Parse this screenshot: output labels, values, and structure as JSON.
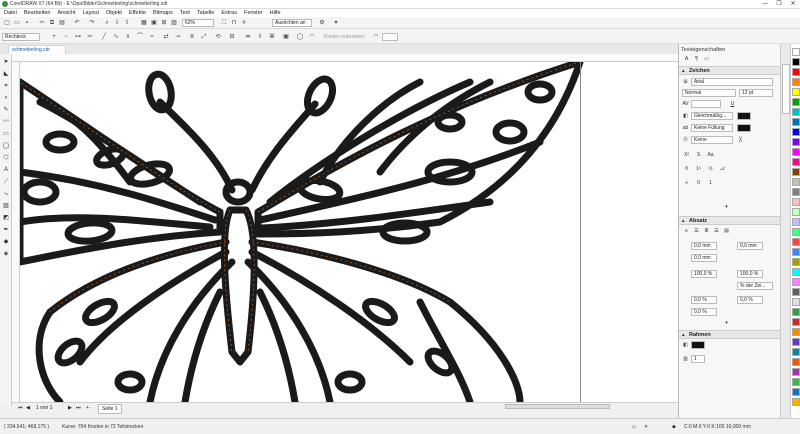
{
  "window": {
    "title": "CorelDRAW X7 (64 Bit) - E:\\Opa\\Bilder\\Schmetterling\\schmetterling.cdr",
    "controls": [
      "—",
      "❐",
      "✕"
    ]
  },
  "menu": [
    "Datei",
    "Bearbeiten",
    "Ansicht",
    "Layout",
    "Objekt",
    "Effekte",
    "Bitmaps",
    "Text",
    "Tabelle",
    "Extras",
    "Fenster",
    "Hilfe"
  ],
  "toolbar": {
    "zoom": "62%",
    "snap": "Ausrichten an",
    "object_type": "Rechteck",
    "smooth_label": "Knoten reduzieren"
  },
  "doc_tab": "schmetterling.cdr",
  "panel": {
    "title": "Texteigenschaften",
    "zeichen": {
      "title": "Zeichen",
      "font": "Arial",
      "style": "Normal",
      "size": "12 pt",
      "fill_uniform": "Gleichmäßig...",
      "fill_none": "Keine Füllung",
      "outline": "Keine"
    },
    "absatz": {
      "title": "Absatz",
      "indent_left": "0,0 mm",
      "indent_right": "0,0 mm",
      "indent_first": "0,0 mm",
      "line_spacing": "100,0 %",
      "char_spacing": "100,0 %",
      "spacing_unit": "% der Zei...",
      "before": "0,0 %",
      "after": "0,0 %",
      "word_spacing": "0,0 %"
    },
    "rahmen": {
      "title": "Rahmen",
      "columns": "1"
    }
  },
  "pagebar": {
    "pages": "1 von 1",
    "page_name": "Seite 1"
  },
  "status": {
    "coords": "( 334,541; 468,175 )",
    "info": "Kurve: 704 Knoten in 72 Teilstrecken",
    "color": "C:0 M:0 Y:0 K:100  10,000 mm"
  },
  "colors": {
    "accent": "#1d5aa8",
    "outline": "#1a1a1a",
    "nodes": "#e0701a"
  },
  "palette": [
    "#ffffff",
    "#000000",
    "#ff0000",
    "#ff8000",
    "#ffff00",
    "#00a000",
    "#00c0c0",
    "#0070c0",
    "#0000ff",
    "#8000ff",
    "#ff00ff",
    "#ff0080",
    "#804000",
    "#c0c0c0",
    "#808080",
    "#ffc0c0",
    "#c0ffc0",
    "#c0c0ff",
    "#40ff80",
    "#ff4040",
    "#4080ff",
    "#a0a000",
    "#00ffff",
    "#ff80ff",
    "#606060",
    "#e0e0e0",
    "#2f9e44",
    "#c92a2a",
    "#f08c00",
    "#5f3dc4",
    "#0c8599",
    "#e8590c",
    "#9c36b5",
    "#37b24d",
    "#1971c2",
    "#fab005"
  ]
}
